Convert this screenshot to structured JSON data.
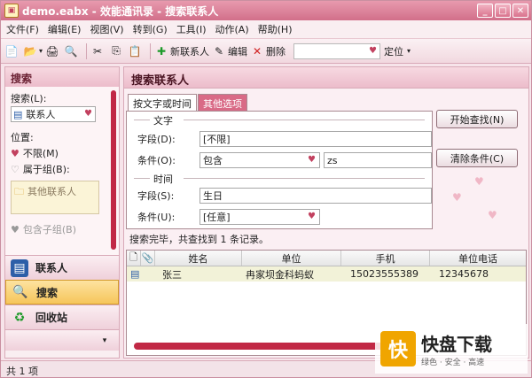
{
  "window": {
    "title": "demo.eabx - 效能通讯录 - 搜索联系人"
  },
  "menu": [
    "文件(F)",
    "编辑(E)",
    "视图(V)",
    "转到(G)",
    "工具(I)",
    "动作(A)",
    "帮助(H)"
  ],
  "toolbar": {
    "new_contact": "新联系人",
    "edit": "编辑",
    "delete": "删除",
    "locate": "定位"
  },
  "sidebar": {
    "title": "搜索",
    "search_label": "搜索(L):",
    "search_value": "联系人",
    "position_label": "位置:",
    "opt_unlimited": "不限(M)",
    "opt_group": "属于组(B):",
    "folder_item": "其他联系人",
    "include_subgroups": "包含子组(B)"
  },
  "nav": [
    "联系人",
    "搜索",
    "回收站"
  ],
  "main": {
    "title": "搜索联系人",
    "tabs": [
      "按文字或时间",
      "其他选项"
    ],
    "group_text": "文字",
    "field_label": "字段(D):",
    "field_value": "[不限]",
    "cond_label": "条件(O):",
    "cond_value": "包含",
    "cond_text": "zs",
    "group_time": "时间",
    "field2_label": "字段(S):",
    "field2_value": "生日",
    "cond2_label": "条件(U):",
    "cond2_value": "[任意]",
    "btn_start": "开始查找(N)",
    "btn_clear": "清除条件(C)",
    "status_msg": "搜索完毕，共查找到 1 条记录。"
  },
  "grid": {
    "columns": [
      "",
      "",
      "姓名",
      "单位",
      "手机",
      "单位电话"
    ],
    "rows": [
      [
        "张三",
        "冉家坝金科蚂蚁",
        "15023555389",
        "12345678"
      ]
    ]
  },
  "statusbar": {
    "count": "共 1 项"
  },
  "watermark": {
    "big": "快盘下载",
    "small": "绿色 · 安全 · 高速"
  }
}
